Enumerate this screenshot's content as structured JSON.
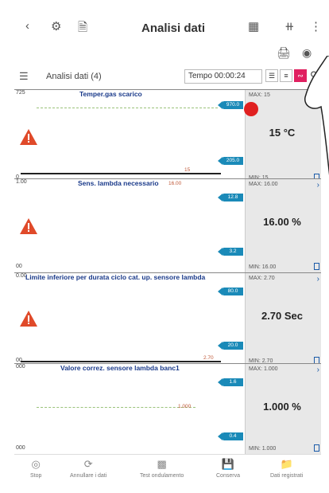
{
  "header": {
    "title": "Analisi dati",
    "back_icon": "chevron-left-icon",
    "icons": [
      "vehicle-icon",
      "document-icon",
      "dtc-icon",
      "fullscreen-icon",
      "more-vertical-icon"
    ]
  },
  "sub_icons": [
    "printer-icon",
    "eye-icon"
  ],
  "toolbar": {
    "label": "Analisi dati (4)",
    "tempo": "Tempo 00:00:24"
  },
  "panels": [
    {
      "title": "Temper.gas scarico",
      "y_top": "725",
      "y_bottom": "0",
      "tag_top": "970.0",
      "tag_bottom": "205.0",
      "value_label": "15",
      "max": "MAX: 15",
      "min": "MIN: 15",
      "value": "15 °C"
    },
    {
      "title": "Sens. lambda necessario",
      "y_top": "1.00",
      "y_bottom": "00",
      "tag_top": "12.8",
      "tag_bottom": "3.2",
      "value_label": "16.00",
      "max": "MAX: 16.00",
      "min": "MIN: 16.00",
      "value": "16.00 %"
    },
    {
      "title": "Limite inferiore per durata ciclo cat. up. sensore lambda",
      "y_top": "0.00",
      "y_bottom": "00",
      "tag_top": "80.0",
      "tag_bottom": "20.0",
      "value_label": "2.70",
      "max": "MAX: 2.70",
      "min": "MIN: 2.70",
      "value": "2.70 Sec"
    },
    {
      "title": "Valore correz. sensore lambda banc1",
      "y_top": "000",
      "y_bottom": "000",
      "tag_top": "1.6",
      "tag_bottom": "0.4",
      "value_label": "1.000",
      "max": "MAX: 1.000",
      "min": "MIN: 1.000",
      "value": "1.000 %"
    }
  ],
  "bottom_nav": [
    {
      "label": "Stop",
      "icon": "stop-icon"
    },
    {
      "label": "Annullare i dati",
      "icon": "refresh-icon"
    },
    {
      "label": "Test ondulamento",
      "icon": "chart-icon"
    },
    {
      "label": "Conserva",
      "icon": "save-icon"
    },
    {
      "label": "Dati registrati",
      "icon": "folder-icon"
    }
  ],
  "colors": {
    "accent_blue": "#1a8ab8",
    "title_blue": "#1a3a8a",
    "warn_red": "#e04a2a",
    "active_red": "#e02020",
    "dash_green": "#9ac27a"
  }
}
